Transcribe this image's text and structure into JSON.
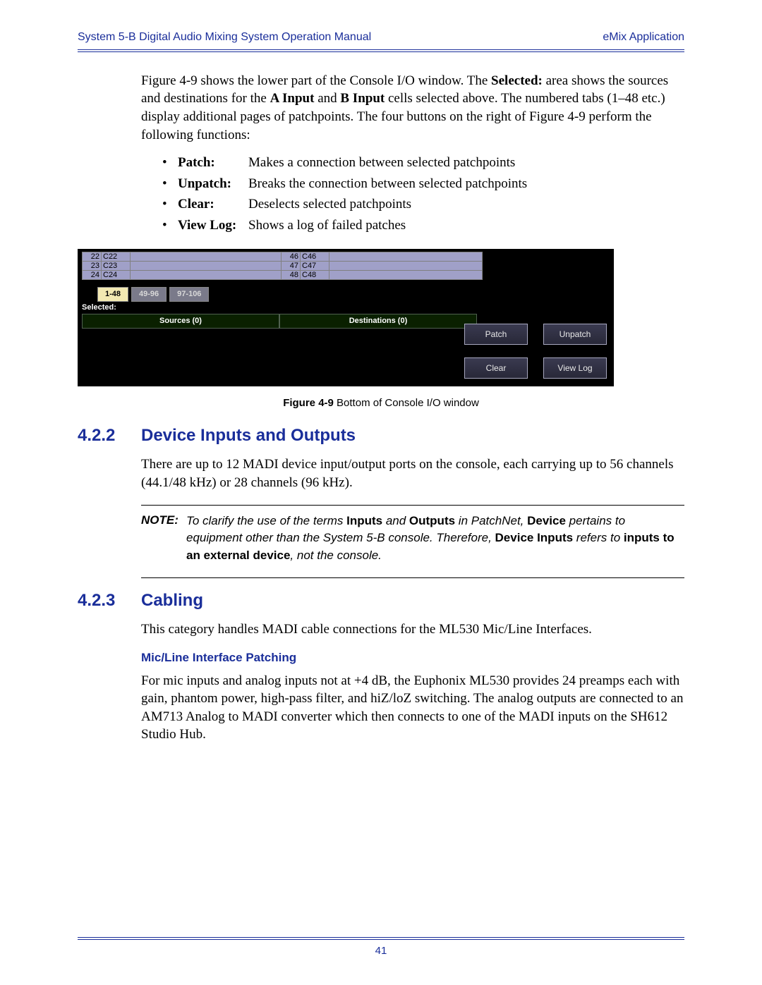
{
  "header": {
    "left": "System 5-B Digital Audio Mixing System Operation Manual",
    "right": "eMix Application"
  },
  "intro_para": "Figure 4-9 shows the lower part of the Console I/O window. The Selected: area shows the sources and destinations for the A Input and B Input cells selected above. The numbered tabs (1–48 etc.) display additional pages of patchpoints. The four buttons on the right of Figure 4-9 perform the following functions:",
  "intro_parts": {
    "p1": "Figure 4-9 shows the lower part of the Console I/O window. The ",
    "b1": "Selected:",
    "p2": " area shows the sources and destinations for the ",
    "b2": "A Input",
    "p3": " and ",
    "b3": "B Input",
    "p4": " cells selected above. The numbered tabs (1–48 etc.) display additional pages of patchpoints. The four buttons on the right of Figure 4-9 perform the following functions:"
  },
  "bullets": [
    {
      "term": "Patch:",
      "desc": "Makes a connection between selected patchpoints"
    },
    {
      "term": "Unpatch:",
      "desc": "Breaks the connection between selected patchpoints"
    },
    {
      "term": "Clear:",
      "desc": "Deselects selected patchpoints"
    },
    {
      "term": "View Log:",
      "desc": "Shows a log of failed patches"
    }
  ],
  "screenshot": {
    "rows_left": [
      {
        "n": "22",
        "l": "C22"
      },
      {
        "n": "23",
        "l": "C23"
      },
      {
        "n": "24",
        "l": "C24"
      }
    ],
    "rows_right": [
      {
        "n": "46",
        "l": "C46"
      },
      {
        "n": "47",
        "l": "C47"
      },
      {
        "n": "48",
        "l": "C48"
      }
    ],
    "tabs": [
      "1-48",
      "49-96",
      "97-106"
    ],
    "selected_label": "Selected:",
    "headers": {
      "sources": "Sources (0)",
      "destinations": "Destinations (0)"
    },
    "buttons": {
      "patch": "Patch",
      "unpatch": "Unpatch",
      "clear": "Clear",
      "viewlog": "View Log"
    }
  },
  "caption": {
    "fig": "Figure 4-9",
    "text": " Bottom of Console I/O window"
  },
  "sec_422": {
    "num": "4.2.2",
    "title": "Device Inputs and Outputs",
    "body": "There are up to 12 MADI device input/output ports on the console, each carrying up to 56 channels (44.1/48 kHz) or 28 channels (96 kHz)."
  },
  "note": {
    "label": "NOTE:",
    "p1": "To clarify the use of the terms ",
    "b1": "Inputs",
    "p2": " and ",
    "b2": "Outputs",
    "p3": " in PatchNet, ",
    "b3": "Device",
    "p4": " pertains to equipment other than the System 5-B console. Therefore, ",
    "b4": "Device Inputs",
    "p5": " refers to ",
    "b5": "inputs to an external device",
    "p6": ", not the console."
  },
  "sec_423": {
    "num": "4.2.3",
    "title": "Cabling",
    "body": "This category handles MADI cable connections for the ML530 Mic/Line Interfaces.",
    "sub_title": "Mic/Line Interface Patching",
    "sub_body": "For mic inputs and analog inputs not at +4 dB, the Euphonix ML530 provides 24 preamps each with gain, phantom power, high-pass filter, and hiZ/loZ switching. The analog outputs are connected to an AM713 Analog to MADI converter which then connects to one of the MADI inputs on the SH612 Studio Hub."
  },
  "page_number": "41"
}
